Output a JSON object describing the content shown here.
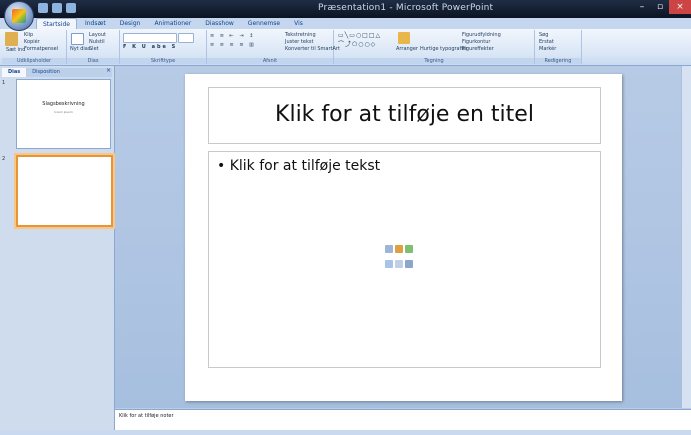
{
  "window": {
    "title": "Præsentation1 - Microsoft PowerPoint"
  },
  "ribbon": {
    "tabs": [
      "Startside",
      "Indsæt",
      "Design",
      "Animationer",
      "Diasshow",
      "Gennemse",
      "Vis"
    ],
    "groups": {
      "clipboard": {
        "paste": "Sæt ind",
        "cut": "Klip",
        "copy": "Kopiér",
        "format_painter": "Formatpensel",
        "label": "Udklipsholder"
      },
      "slides": {
        "new_slide": "Nyt dias",
        "layout": "Layout",
        "reset": "Nulstil",
        "delete": "Slet",
        "label": "Dias"
      },
      "font": {
        "label": "Skrifttype"
      },
      "paragraph": {
        "text_direction": "Tekstretning",
        "align_text": "Juster tekst",
        "convert": "Konverter til SmartArt",
        "label": "Afsnit"
      },
      "drawing": {
        "arrange": "Arranger",
        "quick_styles": "Hurtige typografier",
        "fill": "Figurudfyldning",
        "outline": "Figurkontur",
        "effects": "Figureffekter",
        "label": "Tegning"
      },
      "editing": {
        "find": "Søg",
        "replace": "Erstat",
        "select": "Markér",
        "label": "Redigering"
      }
    }
  },
  "panel": {
    "tabs": [
      "Dias",
      "Disposition"
    ],
    "slides": [
      {
        "number": "1",
        "title": "Slagsbeskrivning",
        "subtitle": "lorem ipsum"
      },
      {
        "number": "2",
        "title": "",
        "subtitle": ""
      }
    ]
  },
  "slide": {
    "title_placeholder": "Klik for at tilføje en titel",
    "body_placeholder": "Klik for at tilføje tekst"
  },
  "notes": {
    "placeholder": "Klik for at tilføje noter"
  },
  "colors": {
    "accent_selected": "#e8943a",
    "ribbon": "#d9e6f6",
    "workspace": "#b7cbe6"
  }
}
